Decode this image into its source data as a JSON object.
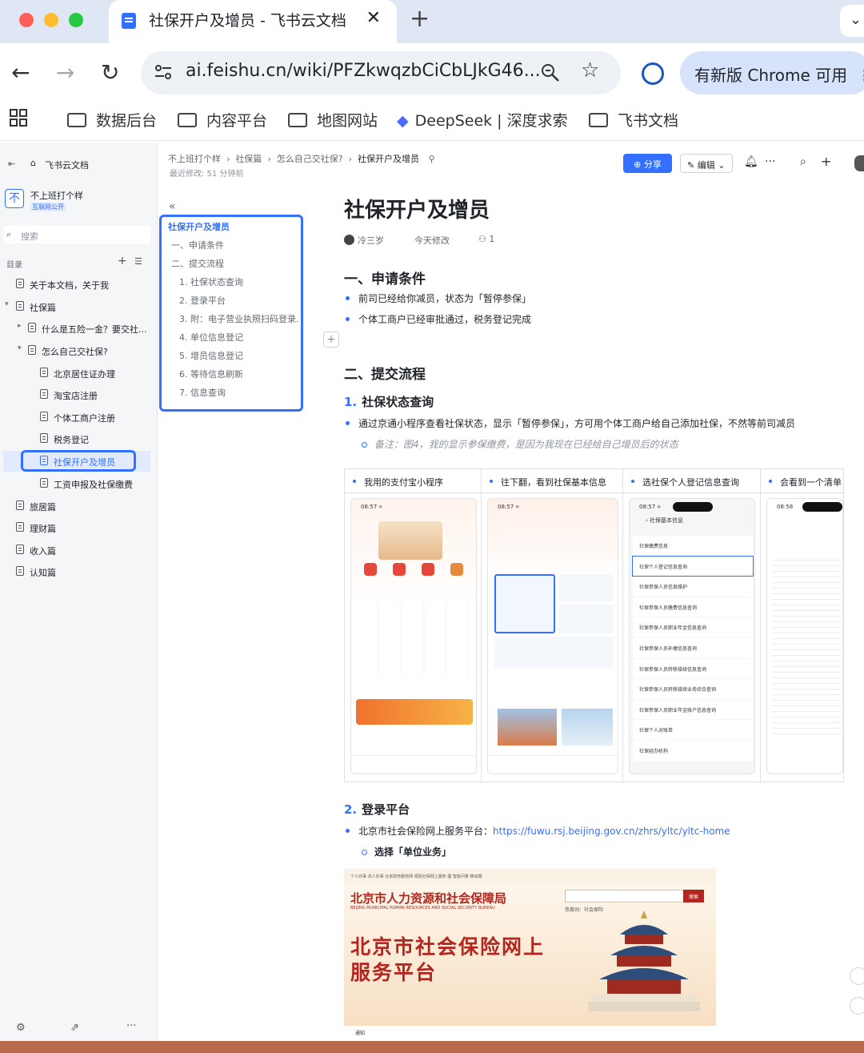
{
  "browser": {
    "tab_title": "社保开户及增员 - 飞书云文档",
    "url": "ai.feishu.cn/wiki/PFZkwqzbCiCbLJkG46...",
    "update_label": "有新版 Chrome 可用",
    "bookmarks": [
      "数据后台",
      "内容平台",
      "地图网站",
      "DeepSeek | 深度求索",
      "飞书文档"
    ]
  },
  "sidebar": {
    "app_name": "飞书云文档",
    "space_name": "不上班打个样",
    "space_badge": "互联网公开",
    "search_placeholder": "搜索",
    "toc_label": "目录",
    "items": [
      {
        "label": "关于本文档，关于我"
      },
      {
        "label": "社保篇"
      },
      {
        "label": "什么是五险一金？要交社..."
      },
      {
        "label": "怎么自己交社保?"
      },
      {
        "label": "北京居住证办理"
      },
      {
        "label": "淘宝店注册"
      },
      {
        "label": "个体工商户注册"
      },
      {
        "label": "税务登记"
      },
      {
        "label": "社保开户及增员"
      },
      {
        "label": "工资申报及社保缴费"
      },
      {
        "label": "旅居篇"
      },
      {
        "label": "理财篇"
      },
      {
        "label": "收入篇"
      },
      {
        "label": "认知篇"
      }
    ]
  },
  "header": {
    "breadcrumb": [
      "不上班打个样",
      "社保篇",
      "怎么自己交社保?",
      "社保开户及增员"
    ],
    "modified": "最近修改: 51 分钟前",
    "share_label": "分享",
    "edit_label": "编辑"
  },
  "toc": {
    "items": [
      "社保开户及增员",
      "一、申请条件",
      "二、提交流程",
      "1. 社保状态查询",
      "2. 登录平台",
      "3. 附：电子营业执照扫码登录...",
      "4. 单位信息登记",
      "5. 增员信息登记",
      "6. 等待信息刷新",
      "7. 信息查询"
    ]
  },
  "doc": {
    "title": "社保开户及增员",
    "author": "冷三岁",
    "modified": "今天修改",
    "viewers": "1",
    "h_conditions": "一、申请条件",
    "conditions": [
      "前司已经给你减员，状态为「暂停参保」",
      "个体工商户已经审批通过，税务登记完成"
    ],
    "h_process": "二、提交流程",
    "step1_num": "1.",
    "step1_title": "社保状态查询",
    "step1_text": "通过京通小程序查看社保状态，显示「暂停参保」，方可用个体工商户给自己添加社保，不然等前司减员",
    "step1_note": "备注：图4，我的显示参保缴费，是因为我现在已经给自己增员后的状态",
    "columns": [
      "我用的支付宝小程序",
      "往下翻，看到社保基本信息",
      "选社保个人登记信息查询",
      "会看到一个清单"
    ],
    "phone2_menu": [
      "社保缴费信息",
      "社保个人登记信息查询",
      "社保参保人员信息维护",
      "社保参保人员缴费信息查询",
      "社保参保人员职业年金信息查询",
      "社保参保人员补缴信息查询",
      "社保参保人员转移接续信息查询",
      "社保参保人员转移接续业务综合查询",
      "社保参保人员职业年金账户信息查询",
      "社保个人对账单",
      "社保经办机构"
    ],
    "phone2_title": "社保基本信息",
    "step2_num": "2.",
    "step2_title": "登录平台",
    "step2_text": "北京市社会保险网上服务平台：",
    "step2_link": "https://fuwu.rsj.beijing.gov.cn/zhrs/yltc/yltc-home",
    "step2_sub": "选择「单位业务」",
    "bj_nav": "个人办事   法人办事   北京政务服务网   便民社保网上服务   图   智能问答   移动端",
    "bj_logo": "北京市人力资源和社会保障局",
    "bj_logo_en": "BEIJING MUNICIPAL HUMAN RESOURCES AND SOCIAL SECURITY BUREAU",
    "bj_search_btn": "搜索",
    "bj_hot": "热搜词：社会保险",
    "bj_title_line1": "北京市社会保险网上",
    "bj_title_line2": "服务平台",
    "bj_notice": "通知"
  },
  "colors": {
    "accent": "#3370ff",
    "highlight": "#3370ff",
    "bj_red": "#b3261e"
  }
}
